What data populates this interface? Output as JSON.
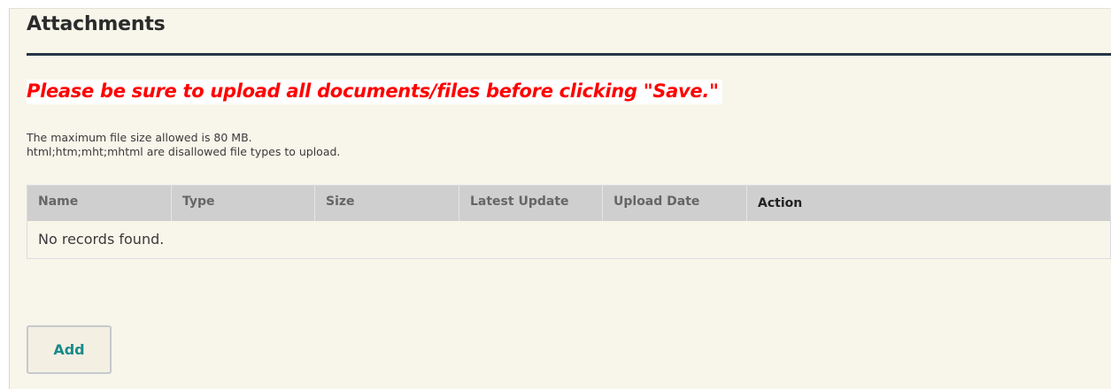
{
  "section": {
    "title": "Attachments"
  },
  "warning": "Please be sure to upload all documents/files before clicking \"Save.\"",
  "info": {
    "max_size": "The maximum file size allowed is 80 MB.",
    "disallowed": "html;htm;mht;mhtml are disallowed file types to upload."
  },
  "table": {
    "columns": [
      "Name",
      "Type",
      "Size",
      "Latest Update",
      "Upload Date",
      "Action"
    ],
    "empty_message": "No records found."
  },
  "buttons": {
    "add": "Add"
  },
  "colors": {
    "warning": "#ff0000",
    "title_rule": "#233547",
    "panel_bg": "#f8f5ea",
    "header_bg": "#cfcfcf",
    "add_text": "#1a8a8a"
  }
}
